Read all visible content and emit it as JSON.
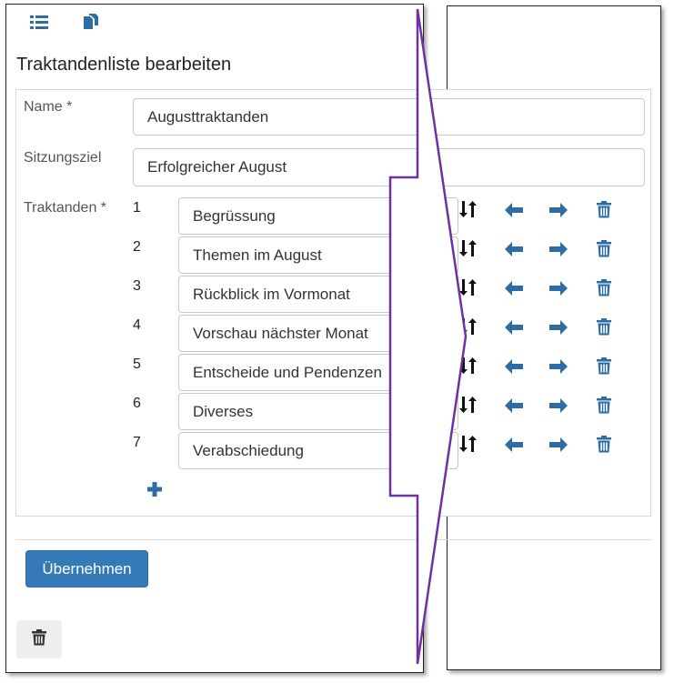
{
  "toolbar": {
    "list_icon": "list-icon",
    "copy_icon": "copy-icon"
  },
  "form": {
    "title": "Traktandenliste bearbeiten",
    "name_label": "Name *",
    "name_value": "Augusttraktanden",
    "goal_label": "Sitzungsziel",
    "goal_value": "Erfolgreicher August",
    "items_label": "Traktanden *",
    "items": [
      {
        "number": "1",
        "value": "Begrüssung"
      },
      {
        "number": "2",
        "value": "Themen im August"
      },
      {
        "number": "3",
        "value": "Rückblick im Vormonat"
      },
      {
        "number": "4",
        "value": "Vorschau nächster Monat"
      },
      {
        "number": "5",
        "value": "Entscheide und Pendenzen"
      },
      {
        "number": "6",
        "value": "Diverses"
      },
      {
        "number": "7",
        "value": "Verabschiedung"
      }
    ],
    "add_icon": "plus-icon",
    "row_actions": [
      "sort-icon",
      "arrow-left-icon",
      "arrow-right-icon",
      "trash-icon"
    ]
  },
  "actions": {
    "apply_label": "Übernehmen",
    "delete_icon": "trash-icon"
  },
  "colors": {
    "accent": "#337ab7",
    "icon_blue": "#2e6da4",
    "callout_arrow": "#7030a0"
  }
}
